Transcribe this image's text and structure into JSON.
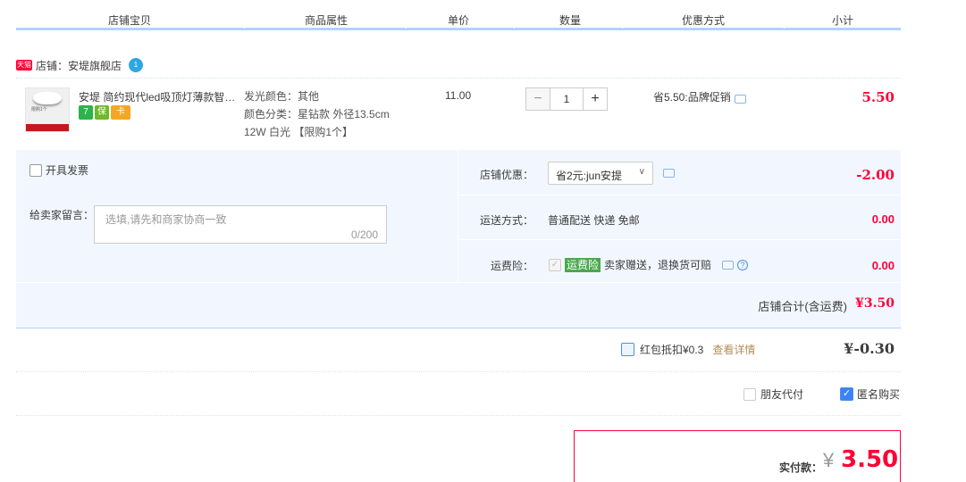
{
  "header": {
    "columns": [
      "店铺宝贝",
      "商品属性",
      "单价",
      "数量",
      "优惠方式",
      "小计"
    ]
  },
  "shop": {
    "badge": "天猫",
    "label": "店铺：安堤旗舰店",
    "wangwang_count": "1"
  },
  "item": {
    "title": "安堤 简约现代led吸顶灯薄款智能卧室灯",
    "thumb_tag": "限购1个",
    "badges": [
      {
        "text": "7",
        "color": "#2cb34a"
      },
      {
        "text": "保",
        "color": "#6fb92c"
      },
      {
        "text": "卡",
        "color": "#f5a623"
      }
    ],
    "props": [
      "发光颜色：其他",
      "颜色分类：星钻款 外径13.5cm",
      "12W 白光 【限购1个】"
    ],
    "price": "11.00",
    "qty_minus": "−",
    "qty": "1",
    "qty_plus": "+",
    "promo": "省5.50:品牌促销",
    "subtotal": "5.50"
  },
  "options": {
    "invoice_label": "开具发票",
    "message_label": "给卖家留言：",
    "message_placeholder": "选填,请先和商家协商一致",
    "message_count": "0/200",
    "shop_discount_label": "店铺优惠：",
    "shop_discount_value": "省2元:jun安提",
    "shop_discount_amount": "-2.00",
    "shipping_label": "运送方式：",
    "shipping_value": "普通配送 快递 免邮",
    "shipping_amount": "0.00",
    "insurance_label": "运费险：",
    "insurance_tag": "运费险",
    "insurance_desc": "卖家赠送，退换货可赔",
    "insurance_amount": "0.00",
    "shop_total_label": "店铺合计(含运费)",
    "shop_total_value": "¥3.50"
  },
  "redpacket": {
    "label": "红包抵扣¥0.3",
    "link": "查看详情",
    "amount": "¥-0.30"
  },
  "purchase": {
    "friend_pay": "朋友代付",
    "anonymous": "匿名购买"
  },
  "pay": {
    "label": "实付款：",
    "currency": "¥",
    "amount": "3.50"
  }
}
